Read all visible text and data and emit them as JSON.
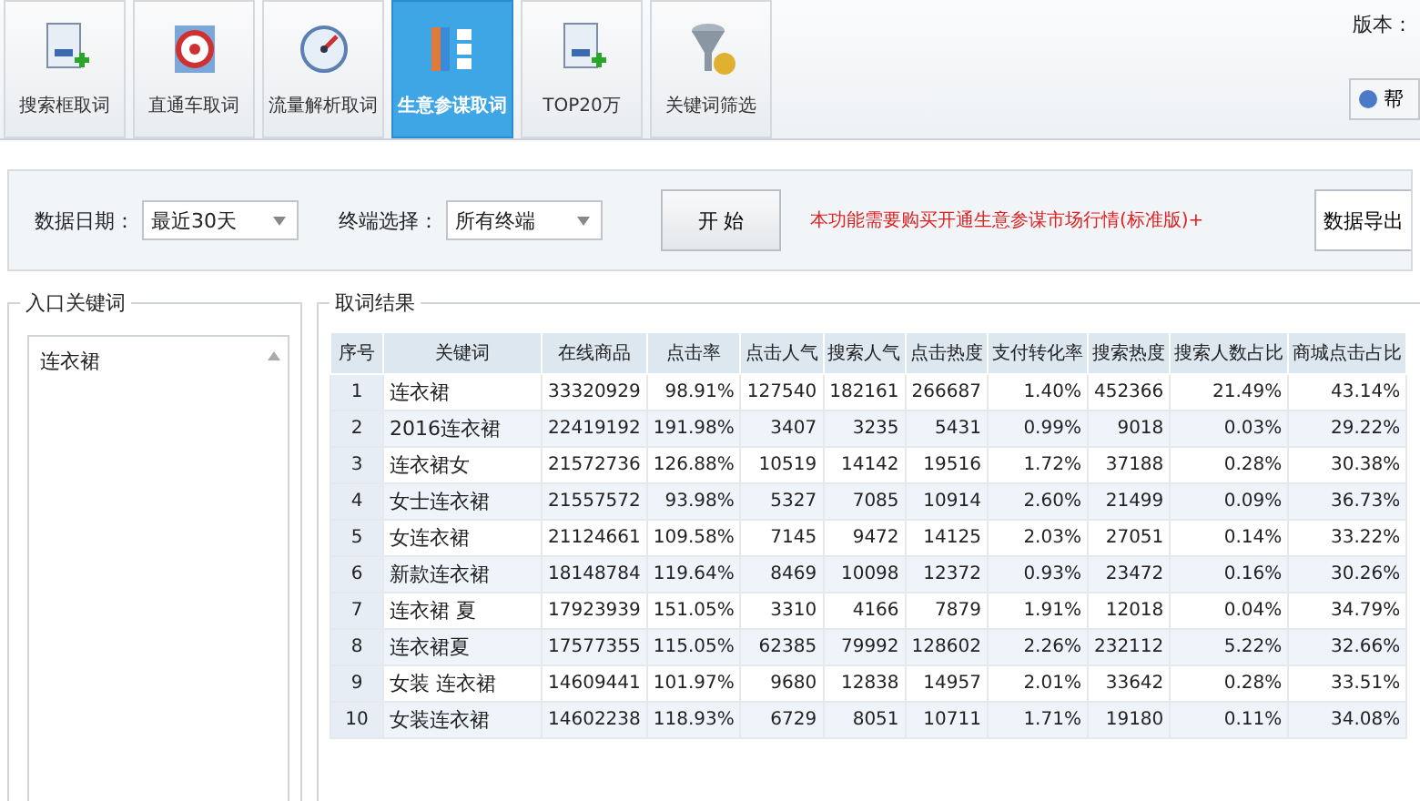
{
  "toolbar": [
    {
      "label": "搜索框取词",
      "selected": false
    },
    {
      "label": "直通车取词",
      "selected": false
    },
    {
      "label": "流量解析取词",
      "selected": false
    },
    {
      "label": "生意参谋取词",
      "selected": true
    },
    {
      "label": "TOP20万",
      "selected": false
    },
    {
      "label": "关键词筛选",
      "selected": false
    }
  ],
  "version_label": "版本：",
  "help_button": "帮",
  "filters": {
    "date_label": "数据日期：",
    "date_value": "最近30天",
    "terminal_label": "终端选择：",
    "terminal_value": "所有终端",
    "start_button": "开 始",
    "notice": "本功能需要购买开通生意参谋市场行情(标准版)+",
    "export_button": "数据导出"
  },
  "entry_panel": {
    "title": "入口关键词",
    "items": [
      "连衣裙"
    ]
  },
  "results": {
    "title": "取词结果",
    "columns": [
      "序号",
      "关键词",
      "在线商品",
      "点击率",
      "点击人气",
      "搜索人气",
      "点击热度",
      "支付转化率",
      "搜索热度",
      "搜索人数占比",
      "商城点击占比"
    ],
    "rows": [
      [
        "1",
        "连衣裙",
        "33320929",
        "98.91%",
        "127540",
        "182161",
        "266687",
        "1.40%",
        "452366",
        "21.49%",
        "43.14%"
      ],
      [
        "2",
        "2016连衣裙",
        "22419192",
        "191.98%",
        "3407",
        "3235",
        "5431",
        "0.99%",
        "9018",
        "0.03%",
        "29.22%"
      ],
      [
        "3",
        "连衣裙女",
        "21572736",
        "126.88%",
        "10519",
        "14142",
        "19516",
        "1.72%",
        "37188",
        "0.28%",
        "30.38%"
      ],
      [
        "4",
        "女士连衣裙",
        "21557572",
        "93.98%",
        "5327",
        "7085",
        "10914",
        "2.60%",
        "21499",
        "0.09%",
        "36.73%"
      ],
      [
        "5",
        "女连衣裙",
        "21124661",
        "109.58%",
        "7145",
        "9472",
        "14125",
        "2.03%",
        "27051",
        "0.14%",
        "33.22%"
      ],
      [
        "6",
        "新款连衣裙",
        "18148784",
        "119.64%",
        "8469",
        "10098",
        "12372",
        "0.93%",
        "23472",
        "0.16%",
        "30.26%"
      ],
      [
        "7",
        "连衣裙 夏",
        "17923939",
        "151.05%",
        "3310",
        "4166",
        "7879",
        "1.91%",
        "12018",
        "0.04%",
        "34.79%"
      ],
      [
        "8",
        "连衣裙夏",
        "17577355",
        "115.05%",
        "62385",
        "79992",
        "128602",
        "2.26%",
        "232112",
        "5.22%",
        "32.66%"
      ],
      [
        "9",
        "女装 连衣裙",
        "14609441",
        "101.97%",
        "9680",
        "12838",
        "14957",
        "2.01%",
        "33642",
        "0.28%",
        "33.51%"
      ],
      [
        "10",
        "女装连衣裙",
        "14602238",
        "118.93%",
        "6729",
        "8051",
        "10711",
        "1.71%",
        "19180",
        "0.11%",
        "34.08%"
      ]
    ]
  }
}
